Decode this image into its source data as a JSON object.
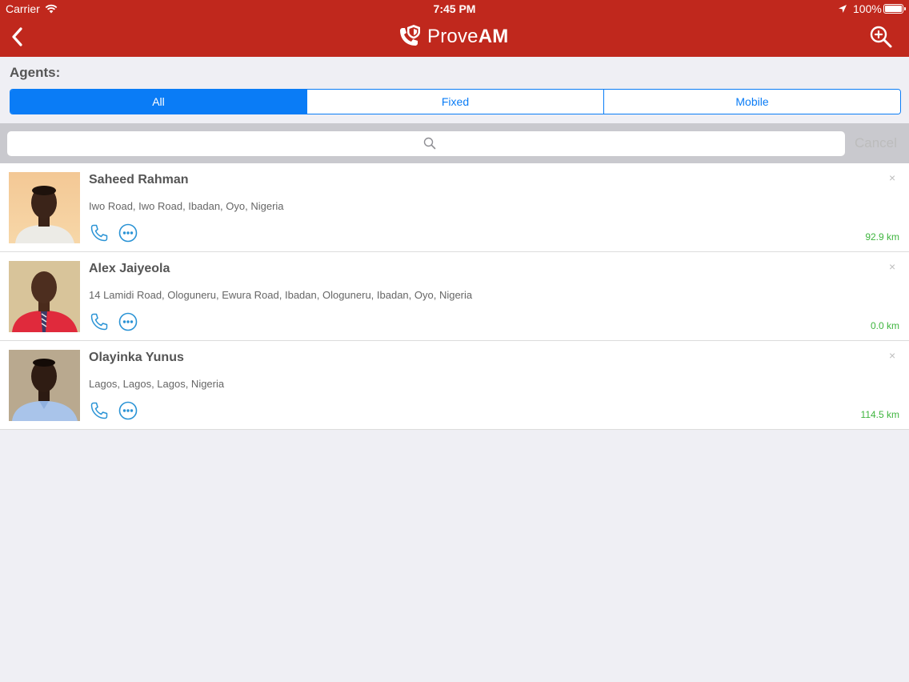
{
  "status_bar": {
    "carrier": "Carrier",
    "time": "7:45 PM",
    "battery": "100%"
  },
  "nav": {
    "brand_prefix": "Prove",
    "brand_suffix": "AM",
    "colors": {
      "bar": "#c0281d"
    }
  },
  "filter": {
    "label": "Agents:",
    "segments": [
      "All",
      "Fixed",
      "Mobile"
    ],
    "selected": "All",
    "accent": "#0a7cf6"
  },
  "search": {
    "placeholder": "",
    "cancel_label": "Cancel"
  },
  "agents": [
    {
      "name": "Saheed Rahman",
      "address": "Iwo Road, Iwo Road, Ibadan, Oyo, Nigeria",
      "distance": "92.9 km",
      "close": "×"
    },
    {
      "name": "Alex Jaiyeola",
      "address": "14 Lamidi Road, Ologuneru, Ewura Road, Ibadan, Ologuneru, Ibadan, Oyo, Nigeria",
      "distance": "0.0 km",
      "close": "×"
    },
    {
      "name": "Olayinka Yunus",
      "address": "Lagos, Lagos, Lagos, Nigeria",
      "distance": "114.5 km",
      "close": "×"
    }
  ]
}
